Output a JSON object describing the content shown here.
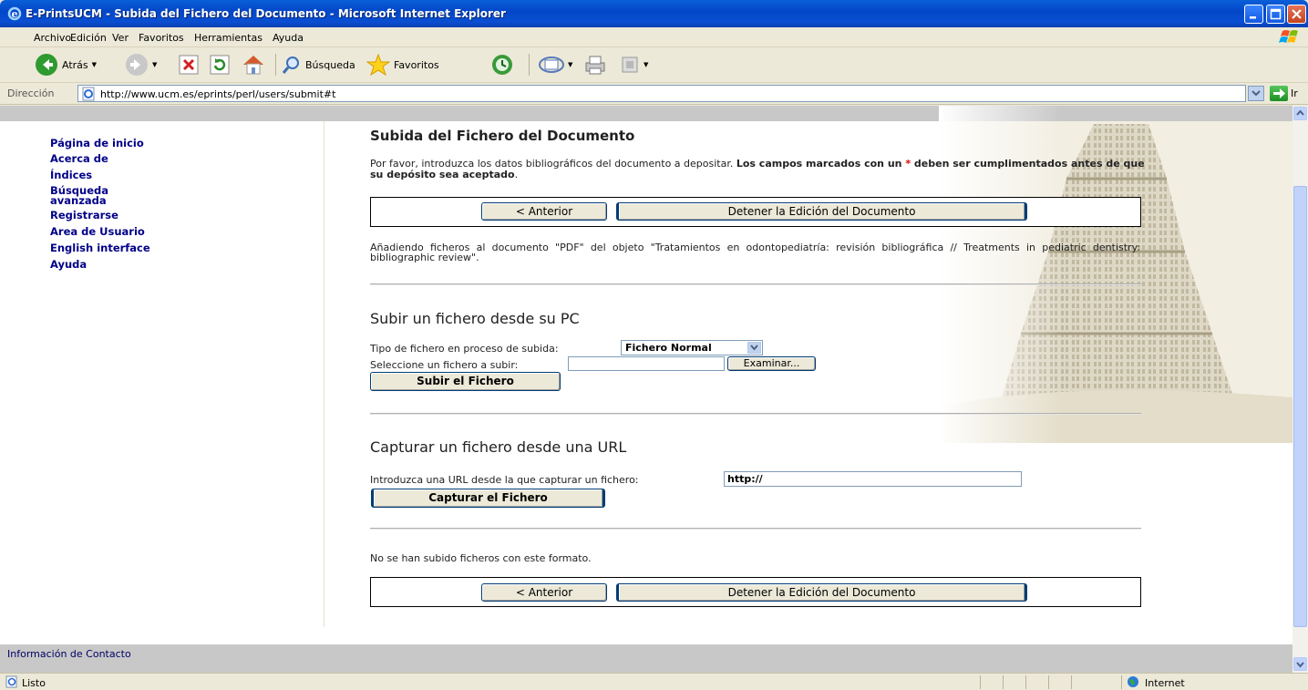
{
  "window": {
    "title": "E-PrintsUCM - Subida del Fichero del Documento - Microsoft Internet Explorer"
  },
  "menu": {
    "items": [
      "Archivo",
      "Edición",
      "Ver",
      "Favoritos",
      "Herramientas",
      "Ayuda"
    ]
  },
  "toolbar": {
    "back_label": "Atrás",
    "search_label": "Búsqueda",
    "favorites_label": "Favoritos"
  },
  "address": {
    "label": "Dirección",
    "url": "http://www.ucm.es/eprints/perl/users/submit#t",
    "go_label": "Ir"
  },
  "sidebar": {
    "items": [
      {
        "label": "Página de inicio"
      },
      {
        "label": "Acerca de"
      },
      {
        "label": "Índices"
      },
      {
        "label": "Búsqueda avanzada"
      },
      {
        "label": "Registrarse"
      },
      {
        "label": "Area de Usuario"
      },
      {
        "label": "English interface"
      },
      {
        "label": "Ayuda"
      }
    ]
  },
  "main": {
    "title": "Subida del Fichero del Documento",
    "intro_plain": "Por favor, introduzca los datos bibliográficos del documento a depositar. ",
    "intro_bold_1": "Los campos marcados con un ",
    "intro_required_mark": "*",
    "intro_bold_2": " deben ser cumplimentados antes de que su depósito sea aceptado",
    "intro_end": ".",
    "prev_button": "< Anterior",
    "stop_button": "Detener la Edición del Documento",
    "adding_text": "Añadiendo ficheros al documento \"PDF\" del objeto \"Tratamientos en odontopediatría: revisión bibliográfica // Treatments in pediatric dentistry: bibliographic review\".",
    "upload_section": {
      "title": "Subir un fichero desde su PC",
      "type_label": "Tipo de fichero en proceso de subida:",
      "type_value": "Fichero Normal",
      "file_label": "Seleccione un fichero a subir:",
      "file_value": "",
      "browse_button": "Examinar...",
      "submit_button": "Subir el Fichero"
    },
    "url_section": {
      "title": "Capturar un fichero desde una URL",
      "url_label": "Introduzca una URL desde la que capturar un fichero:",
      "url_value": "http://",
      "submit_button": "Capturar el Fichero"
    },
    "no_files_text": "No se han subido ficheros con este formato."
  },
  "footer": {
    "contact": "Información de Contacto"
  },
  "status": {
    "text": "Listo",
    "zone": "Internet"
  },
  "colors": {
    "link": "#000088",
    "titlebar": "#0a4ed2",
    "required": "#dd0000"
  }
}
